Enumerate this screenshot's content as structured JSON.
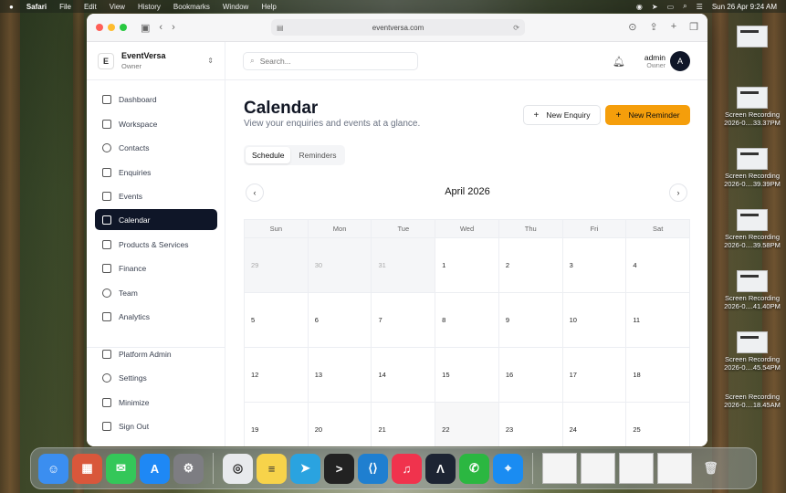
{
  "menubar": {
    "app": "Safari",
    "menus": [
      "File",
      "Edit",
      "View",
      "History",
      "Bookmarks",
      "Window",
      "Help"
    ],
    "datetime": "Sun 26 Apr  9:24 AM"
  },
  "desktop_files": [
    {
      "line1": "Screen Recording",
      "line2": "2026-0....33.37PM"
    },
    {
      "line1": "Screen Recording",
      "line2": "2026-0....39.39PM"
    },
    {
      "line1": "Screen Recording",
      "line2": "2026-0....39.58PM"
    },
    {
      "line1": "Screen Recording",
      "line2": "2026-0....41.40PM"
    },
    {
      "line1": "Screen Recording",
      "line2": "2026-0....45.54PM"
    },
    {
      "line1": "Screen Recording",
      "line2": "2026-0....18.45AM"
    }
  ],
  "browser": {
    "url": "eventversa.com"
  },
  "org": {
    "name": "EventVersa",
    "role": "Owner",
    "logo_text": "E"
  },
  "sidebar": {
    "items": [
      {
        "label": "Dashboard",
        "icon": "dashboard-icon"
      },
      {
        "label": "Workspace",
        "icon": "briefcase-icon"
      },
      {
        "label": "Contacts",
        "icon": "contacts-icon"
      },
      {
        "label": "Enquiries",
        "icon": "inbox-icon"
      },
      {
        "label": "Events",
        "icon": "document-icon"
      },
      {
        "label": "Calendar",
        "icon": "calendar-icon"
      },
      {
        "label": "Products & Services",
        "icon": "box-icon"
      },
      {
        "label": "Finance",
        "icon": "card-icon"
      },
      {
        "label": "Team",
        "icon": "team-icon"
      },
      {
        "label": "Analytics",
        "icon": "analytics-icon"
      }
    ],
    "bottom_items": [
      {
        "label": "Platform Admin",
        "icon": "shield-icon"
      },
      {
        "label": "Settings",
        "icon": "gear-icon"
      },
      {
        "label": "Minimize",
        "icon": "minimize-icon"
      },
      {
        "label": "Sign Out",
        "icon": "sign-out-icon"
      }
    ],
    "active": "Calendar"
  },
  "header": {
    "search_placeholder": "Search...",
    "user_name": "admin",
    "user_role": "Owner",
    "avatar_initial": "A"
  },
  "page": {
    "title": "Calendar",
    "subtitle": "View your enquiries and events at a glance.",
    "new_enquiry": "New Enquiry",
    "new_reminder": "New Reminder",
    "tabs": [
      "Schedule",
      "Reminders"
    ],
    "active_tab": "Schedule"
  },
  "calendar": {
    "month_label": "April 2026",
    "weekdays": [
      "Sun",
      "Mon",
      "Tue",
      "Wed",
      "Thu",
      "Fri",
      "Sat"
    ],
    "weeks": [
      [
        {
          "d": "29",
          "m": true
        },
        {
          "d": "30",
          "m": true
        },
        {
          "d": "31",
          "m": true
        },
        {
          "d": "1"
        },
        {
          "d": "2"
        },
        {
          "d": "3"
        },
        {
          "d": "4"
        }
      ],
      [
        {
          "d": "5"
        },
        {
          "d": "6"
        },
        {
          "d": "7"
        },
        {
          "d": "8"
        },
        {
          "d": "9"
        },
        {
          "d": "10"
        },
        {
          "d": "11"
        }
      ],
      [
        {
          "d": "12"
        },
        {
          "d": "13"
        },
        {
          "d": "14"
        },
        {
          "d": "15"
        },
        {
          "d": "16"
        },
        {
          "d": "17"
        },
        {
          "d": "18"
        }
      ],
      [
        {
          "d": "19"
        },
        {
          "d": "20"
        },
        {
          "d": "21"
        },
        {
          "d": "22",
          "t": true
        },
        {
          "d": "23"
        },
        {
          "d": "24"
        },
        {
          "d": "25"
        }
      ]
    ]
  },
  "colors": {
    "accent": "#f59e0b",
    "active_nav": "#0f1628"
  },
  "dock": {
    "apps": [
      {
        "name": "finder-icon",
        "color": "#3b8ef0",
        "glyph": "☺"
      },
      {
        "name": "launchpad-icon",
        "color": "#d9573b",
        "glyph": "▦"
      },
      {
        "name": "messages-icon",
        "color": "#34c759",
        "glyph": "✉"
      },
      {
        "name": "app-store-icon",
        "color": "#1e88f5",
        "glyph": "A"
      },
      {
        "name": "system-settings-icon",
        "color": "#7d7d82",
        "glyph": "⚙"
      },
      {
        "name": "chrome-icon",
        "color": "#e8eaed",
        "glyph": "◎"
      },
      {
        "name": "notes-icon",
        "color": "#f7d34a",
        "glyph": "≡"
      },
      {
        "name": "telegram-icon",
        "color": "#2aa3e0",
        "glyph": "➤"
      },
      {
        "name": "terminal-icon",
        "color": "#222222",
        "glyph": ">"
      },
      {
        "name": "vscode-icon",
        "color": "#1f7fd0",
        "glyph": "⟨⟩"
      },
      {
        "name": "music-icon",
        "color": "#f0334d",
        "glyph": "♫"
      },
      {
        "name": "arc-icon",
        "color": "#1d2433",
        "glyph": "Λ"
      },
      {
        "name": "whatsapp-icon",
        "color": "#2bb741",
        "glyph": "✆"
      },
      {
        "name": "safari-icon",
        "color": "#1a8cf2",
        "glyph": "⌖"
      }
    ]
  }
}
